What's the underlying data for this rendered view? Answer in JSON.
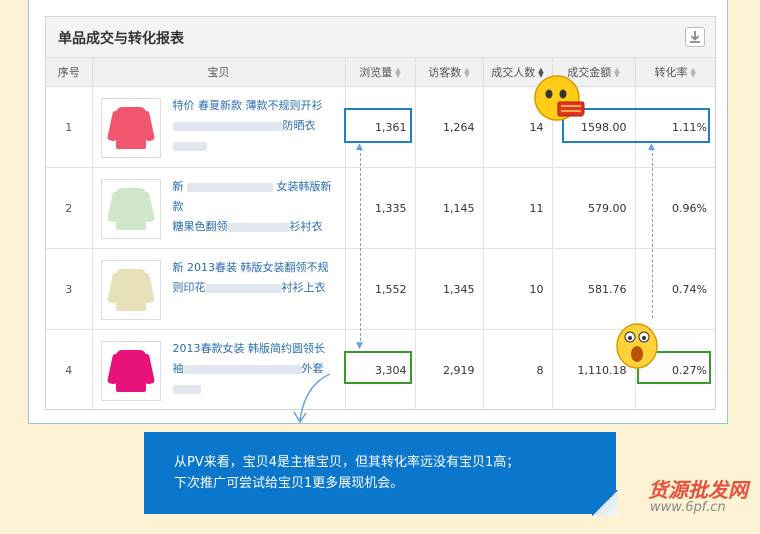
{
  "panel": {
    "title": "单品成交与转化报表"
  },
  "columns": [
    "序号",
    "宝贝",
    "浏览量",
    "访客数",
    "成交人数",
    "成交金额",
    "转化率"
  ],
  "rows": [
    {
      "index": "1",
      "title_line1": "特价 春夏新款 薄款不规则开衫",
      "title_line2_tail": "防晒衣",
      "pv": "1,361",
      "uv": "1,264",
      "buyers": "14",
      "amount": "1598.00",
      "rate": "1.11%",
      "item_color": "#f0566d"
    },
    {
      "index": "2",
      "title_line1_head": "新",
      "title_line1_tail": "女装韩版新款",
      "title_line2_head": "糖果色翻领",
      "title_line2_tail": "衫衬衣",
      "pv": "1,335",
      "uv": "1,145",
      "buyers": "11",
      "amount": "579.00",
      "rate": "0.96%",
      "item_color": "#cfe6c8"
    },
    {
      "index": "3",
      "title_line1": "新 2013春装 韩版女装翻领不规",
      "title_line2_head": "则印花",
      "title_line2_tail": "衬衫上衣",
      "pv": "1,552",
      "uv": "1,345",
      "buyers": "10",
      "amount": "581.76",
      "rate": "0.74%",
      "item_color": "#e8e0b8"
    },
    {
      "index": "4",
      "title_line1": "2013春款女装 韩版简约圆领长",
      "title_line2_head": "袖",
      "title_line2_tail": "外套",
      "pv": "3,304",
      "uv": "2,919",
      "buyers": "8",
      "amount": "1,110.18",
      "rate": "0.27%",
      "item_color": "#e8137a"
    }
  ],
  "banner": {
    "line1": "从PV来看，宝贝4是主推宝贝，但其转化率远没有宝贝1高；",
    "line2": "下次推广可尝试给宝贝1更多展现机会。",
    "color": "#0a76cc"
  },
  "watermark": {
    "text": "货源批发网",
    "url": "www.6pf.cn"
  },
  "highlight_colors": {
    "blue": "#1e7fc2",
    "green": "#3a9a2b"
  },
  "icons": {
    "download": "download-icon",
    "sort": "sort-arrows-icon"
  }
}
